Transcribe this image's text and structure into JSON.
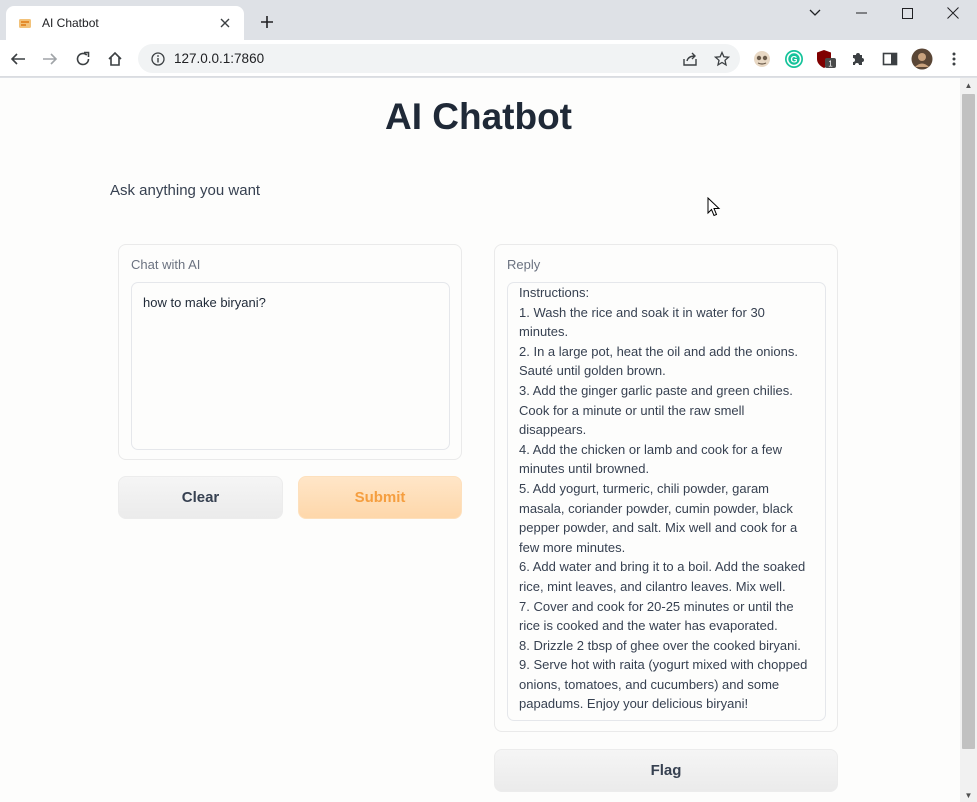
{
  "browser": {
    "tab_title": "AI Chatbot",
    "url": "127.0.0.1:7860",
    "icons": [
      "favicon-icon",
      "close-icon",
      "plus-icon",
      "chevron-down-icon",
      "minimize-icon",
      "maximize-icon",
      "close-window-icon",
      "back-icon",
      "forward-icon",
      "reload-icon",
      "home-icon",
      "info-icon",
      "share-icon",
      "star-icon",
      "extension-icon",
      "grammarly-icon",
      "ublock-icon",
      "puzzle-icon",
      "sidepanel-icon",
      "profile-avatar",
      "menu-icon"
    ],
    "ublock_badge": "1",
    "grammarly_letter": "G"
  },
  "page": {
    "title": "AI Chatbot",
    "description": "Ask anything you want"
  },
  "chat": {
    "label": "Chat with AI",
    "input_value": "how to make biryani?"
  },
  "buttons": {
    "clear": "Clear",
    "submit": "Submit",
    "flag": "Flag"
  },
  "reply": {
    "label": "Reply",
    "lines": [
      "Instructions:",
      "1. Wash the rice and soak it in water for 30",
      "minutes.",
      "2. In a large pot, heat the oil and add the onions.",
      "Sauté until golden brown.",
      "3. Add the ginger garlic paste and green chilies.",
      "Cook for a minute or until the raw smell",
      "disappears.",
      "4. Add the chicken or lamb and cook for a few",
      "minutes until browned.",
      "5. Add yogurt, turmeric, chili powder, garam",
      "masala, coriander powder, cumin powder, black",
      "pepper powder, and salt. Mix well and cook for a",
      "few more minutes.",
      "6. Add water and bring it to a boil. Add the soaked",
      "rice, mint leaves, and cilantro leaves. Mix well.",
      "7. Cover and cook for 20-25 minutes or until the",
      "rice is cooked and the water has evaporated.",
      "8. Drizzle 2 tbsp of ghee over the cooked biryani.",
      "9. Serve hot with raita (yogurt mixed with chopped",
      "onions, tomatoes, and cucumbers) and some",
      "papadums. Enjoy your delicious biryani!"
    ]
  },
  "colors": {
    "submit_bg": "#fed7aa",
    "submit_text": "#f59e3f",
    "page_bg": "#fdfdfc",
    "chrome_bg": "#dee1e6"
  }
}
